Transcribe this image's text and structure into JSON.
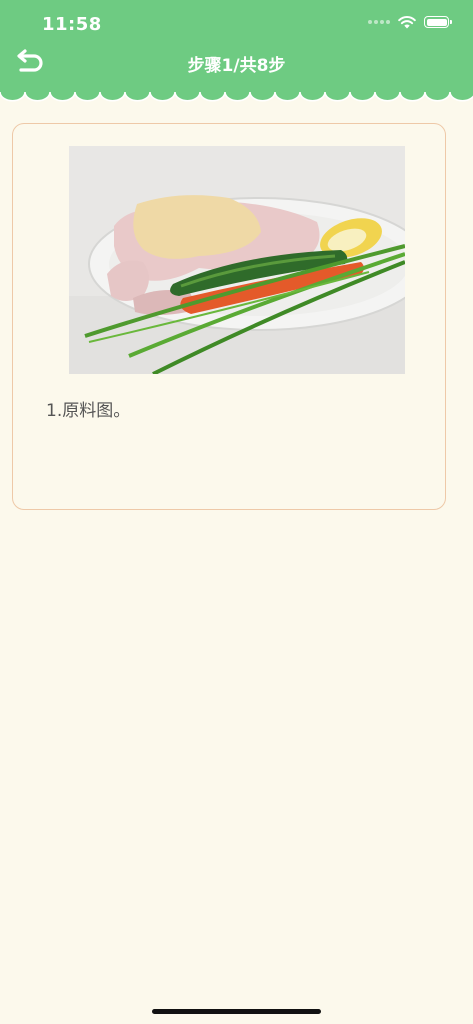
{
  "status_bar": {
    "time": "11:58",
    "icons": [
      "signal-icon",
      "wifi-icon",
      "battery-icon"
    ]
  },
  "header": {
    "title": "步骤1/共8步",
    "back_icon": "back-arrow-icon",
    "background_color": "#6ecb82"
  },
  "step": {
    "image_subject": "chicken-vegetables-photo",
    "text": "1.原料图。"
  },
  "colors": {
    "accent": "#6ecb82",
    "page_background": "#fcf9ec",
    "card_border": "#eec9a8",
    "text": "#555555"
  }
}
